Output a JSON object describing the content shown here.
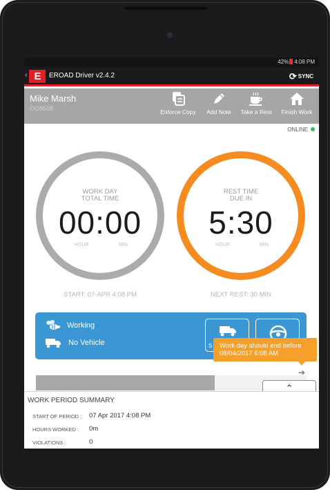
{
  "status_bar": {
    "battery": "42%",
    "time": "4:08 PM"
  },
  "app": {
    "logo_text": "E",
    "title": "EROAD Driver v2.4.2",
    "sync_label": "SYNC"
  },
  "driver": {
    "name": "Mike Marsh",
    "id": "OO8658"
  },
  "toolbar": {
    "enforce_copy": "Enforce Copy",
    "add_note": "Add Note",
    "take_rest": "Take a Rest",
    "finish_work": "Finish Work"
  },
  "connection": {
    "status": "ONLINE",
    "color": "#2fbf4a"
  },
  "work_dial": {
    "label_line1": "WORK DAY",
    "label_line2": "TOTAL TIME",
    "value": "00:00",
    "unit_hour": "HOUR",
    "unit_min": "MIN",
    "caption": "START: 07-APR 4:08 PM",
    "color": "#ababab"
  },
  "rest_dial": {
    "label_line1": "REST TIME",
    "label_line2": "DUE IN",
    "value": "5:30",
    "unit_hour": "HOUR",
    "unit_min": "MIN",
    "caption": "NEXT REST: 30 MIN",
    "color": "#f68b1f"
  },
  "status_panel": {
    "activity": "Working",
    "vehicle": "No Vehicle",
    "vehicle_button_label": "S",
    "color": "#3a97d4"
  },
  "tooltip": {
    "line1": "Work day should end before",
    "line2": "08/04/2017 6:08 AM"
  },
  "timeline": {
    "elapsed_fraction": 0.66
  },
  "summary": {
    "title": "WORK PERIOD SUMMARY",
    "start_label": "START OF PERIOD :",
    "start_value": "07 Apr 2017 4:08 PM",
    "hours_label": "HOURS WORKED :",
    "hours_value": "0m",
    "violations_label": "VIOLATIONS :",
    "violations_value": "0"
  },
  "icons": {
    "back": "chevron-left",
    "sync": "sync-arrows",
    "enforce_copy": "document-copy",
    "add_note": "pencil",
    "take_rest": "coffee-cup",
    "finish_work": "house",
    "working": "bee",
    "no_vehicle": "truck",
    "vehicle_button": "truck",
    "drive_button": "steering-wheel",
    "timeline_arrow": "arrow-right",
    "collapse": "double-chevron-up"
  }
}
